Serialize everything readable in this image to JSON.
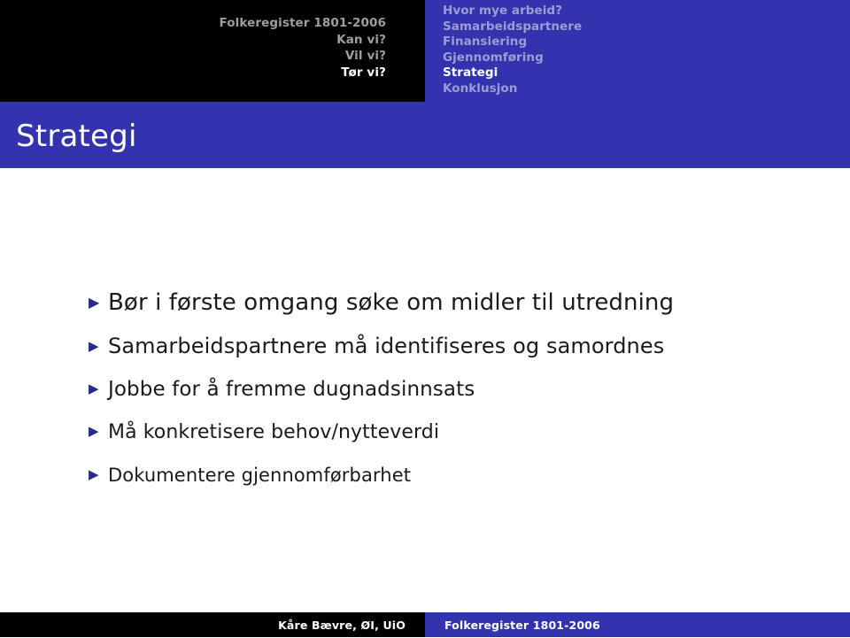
{
  "header": {
    "title_lines": [
      {
        "text": "Folkeregister 1801-2006",
        "active": false
      },
      {
        "text": "Kan vi?",
        "active": false
      },
      {
        "text": "Vil vi?",
        "active": false
      },
      {
        "text": "Tør vi?",
        "active": true
      }
    ],
    "nav_items": [
      {
        "label": "Hvor mye arbeid?",
        "active": false
      },
      {
        "label": "Samarbeidspartnere",
        "active": false
      },
      {
        "label": "Finansiering",
        "active": false
      },
      {
        "label": "Gjennomføring",
        "active": false
      },
      {
        "label": "Strategi",
        "active": true
      },
      {
        "label": "Konklusjon",
        "active": false
      }
    ]
  },
  "title_band": {
    "title": "Strategi"
  },
  "body": {
    "bullet_marker": "▶",
    "bullets": [
      {
        "text": "Bør i første omgang søke om midler til utredning"
      },
      {
        "text": "Samarbeidspartnere må identifiseres og samordnes"
      },
      {
        "text": "Jobbe for å fremme dugnadsinnsats"
      },
      {
        "text": "Må konkretisere behov/nytteverdi"
      },
      {
        "text": "Dokumentere gjennomførbarhet"
      }
    ]
  },
  "footer": {
    "author": "Kåre Bævre, ØI, UiO",
    "document": "Folkeregister 1801-2006"
  },
  "colors": {
    "accent_blue": "#3333af",
    "header_black": "#000000",
    "nav_inactive": "#9d9dd4",
    "nav_active": "#ffffff",
    "header_title_inactive": "#9d9da4",
    "bullet_marker": "#2a2a8c",
    "body_text": "#1a1a1a"
  }
}
